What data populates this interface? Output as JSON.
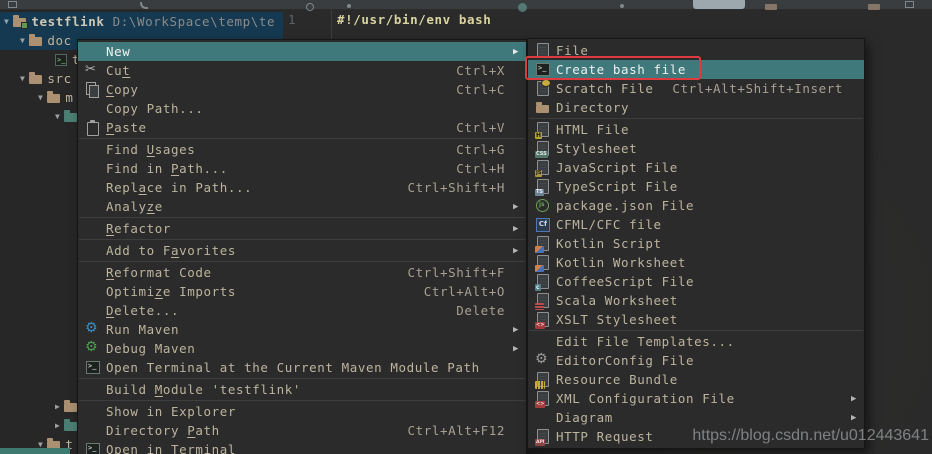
{
  "glyphs": {
    "submenu_arrow": "▶",
    "expanded": "▼",
    "collapsed": "▶"
  },
  "editor": {
    "line_number": "1",
    "code": "#!/usr/bin/env bash"
  },
  "project_tree": {
    "root_label": "testflink",
    "root_path": "D:\\WorkSpace\\temp\\te",
    "nodes": {
      "doc": "doc",
      "t_file": "t",
      "src": "src",
      "m_folder": "m",
      "bottom_t_folder": "t"
    }
  },
  "context_menu": {
    "items": [
      {
        "label": "New",
        "selected": true,
        "submenu": true
      },
      {
        "label": "Cut",
        "icon": "cut-icon",
        "shortcut": "Ctrl+X",
        "mnemonic": 2
      },
      {
        "label": "Copy",
        "icon": "copy-icon",
        "shortcut": "Ctrl+C",
        "mnemonic": 0
      },
      {
        "label": "Copy Path..."
      },
      {
        "label": "Paste",
        "icon": "paste-icon",
        "shortcut": "Ctrl+V",
        "mnemonic": 0
      },
      {
        "separator": true
      },
      {
        "label": "Find Usages",
        "shortcut": "Ctrl+G",
        "mnemonic": 5
      },
      {
        "label": "Find in Path...",
        "shortcut": "Ctrl+H",
        "mnemonic": 8
      },
      {
        "label": "Replace in Path...",
        "shortcut": "Ctrl+Shift+H",
        "mnemonic": 4
      },
      {
        "label": "Analyze",
        "submenu": true,
        "mnemonic": 5
      },
      {
        "separator": true
      },
      {
        "label": "Refactor",
        "submenu": true,
        "mnemonic": 0
      },
      {
        "separator": true
      },
      {
        "label": "Add to Favorites",
        "submenu": true,
        "mnemonic": 8
      },
      {
        "separator": true
      },
      {
        "label": "Reformat Code",
        "shortcut": "Ctrl+Shift+F",
        "mnemonic": 0
      },
      {
        "label": "Optimize Imports",
        "shortcut": "Ctrl+Alt+O",
        "mnemonic": 6
      },
      {
        "label": "Delete...",
        "shortcut": "Delete",
        "mnemonic": 0
      },
      {
        "label": "Run Maven",
        "icon": "maven-run-gear-icon",
        "submenu": true
      },
      {
        "label": "Debug Maven",
        "icon": "maven-debug-gear-icon",
        "submenu": true
      },
      {
        "label": "Open Terminal at the Current Maven Module Path",
        "icon": "terminal-icon"
      },
      {
        "separator": true
      },
      {
        "label": "Build Module 'testflink'",
        "mnemonic": 6
      },
      {
        "separator": true
      },
      {
        "label": "Show in Explorer"
      },
      {
        "label": "Directory Path",
        "shortcut": "Ctrl+Alt+F12",
        "mnemonic": 10
      },
      {
        "label": "Open in Terminal",
        "icon": "terminal-icon"
      }
    ]
  },
  "new_submenu": {
    "items": [
      {
        "label": "File",
        "icon": "file-icon"
      },
      {
        "label": "Create bash file",
        "icon": "bash-file-icon",
        "selected": true,
        "annotated": true
      },
      {
        "label": "Scratch File",
        "icon": "scratch-file-icon",
        "shortcut": "Ctrl+Alt+Shift+Insert"
      },
      {
        "label": "Directory",
        "icon": "folder-icon"
      },
      {
        "separator": true
      },
      {
        "label": "HTML File",
        "icon": "html-file-icon"
      },
      {
        "label": "Stylesheet",
        "icon": "stylesheet-icon"
      },
      {
        "label": "JavaScript File",
        "icon": "javascript-file-icon"
      },
      {
        "label": "TypeScript File",
        "icon": "typescript-file-icon"
      },
      {
        "label": "package.json File",
        "icon": "package-json-icon"
      },
      {
        "label": "CFML/CFC file",
        "icon": "cfml-file-icon"
      },
      {
        "label": "Kotlin Script",
        "icon": "kotlin-file-icon"
      },
      {
        "label": "Kotlin Worksheet",
        "icon": "kotlin-file-icon"
      },
      {
        "label": "CoffeeScript File",
        "icon": "coffeescript-file-icon"
      },
      {
        "label": "Scala Worksheet",
        "icon": "scala-file-icon"
      },
      {
        "label": "XSLT Stylesheet",
        "icon": "xslt-file-icon"
      },
      {
        "separator": true
      },
      {
        "label": "Edit File Templates..."
      },
      {
        "label": "EditorConfig File",
        "icon": "editorconfig-gear-icon"
      },
      {
        "label": "Resource Bundle",
        "icon": "resource-bundle-icon"
      },
      {
        "label": "XML Configuration File",
        "icon": "xml-file-icon",
        "submenu": true
      },
      {
        "label": "Diagram",
        "submenu": true
      },
      {
        "label": "HTTP Request",
        "icon": "http-request-icon"
      }
    ]
  },
  "watermark": "https://blog.csdn.net/u012443641",
  "colors": {
    "menu_selection_teal": "#3f797c",
    "tree_selection_blue": "#153950",
    "annotation_red": "#dd3b3f",
    "menu_bg": "#2b2b2b",
    "editor_bg": "#2a2a2a"
  }
}
